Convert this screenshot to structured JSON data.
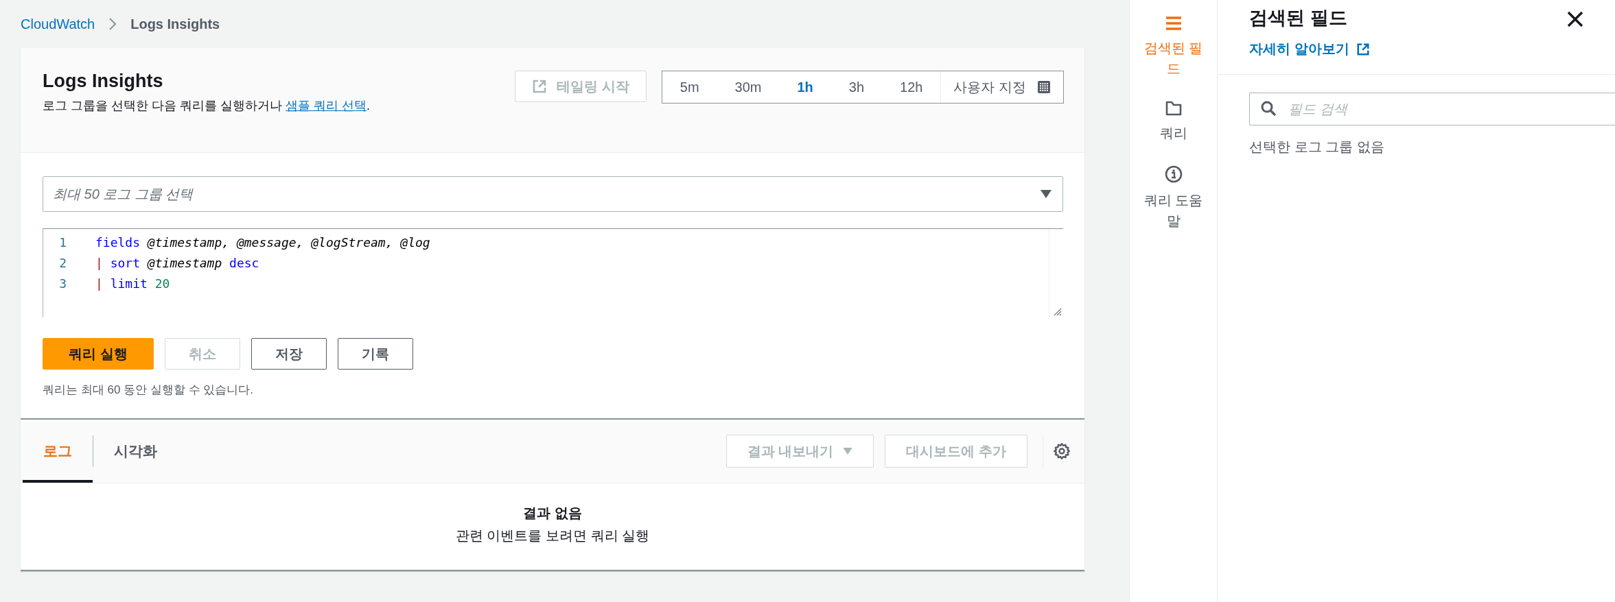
{
  "breadcrumb": [
    {
      "label": "CloudWatch",
      "kind": "link"
    },
    {
      "label": "Logs Insights",
      "kind": "current"
    }
  ],
  "header": {
    "title": "Logs Insights",
    "description": {
      "before": "로그 그룹을 선택한 다음 쿼리를 실행하거나 ",
      "link": "샘플 쿼리 선택",
      "after": "."
    },
    "tail_button": {
      "label": "테일링 시작",
      "disabled": true
    },
    "time_ranges": [
      {
        "label": "5m",
        "selected": false
      },
      {
        "label": "30m",
        "selected": false
      },
      {
        "label": "1h",
        "selected": true
      },
      {
        "label": "3h",
        "selected": false
      },
      {
        "label": "12h",
        "selected": false
      },
      {
        "label": "사용자 지정",
        "selected": false
      }
    ]
  },
  "log_group_select": {
    "placeholder": "최대 50 로그 그룹 선택"
  },
  "editor": {
    "lines": [
      {
        "number": "1",
        "tokens": [
          {
            "text": "fields",
            "kind": "keyword"
          },
          {
            "text": " @timestamp, @message, @logStream, @log",
            "kind": "field"
          }
        ]
      },
      {
        "number": "2",
        "tokens": [
          {
            "text": "|",
            "kind": "pipe"
          },
          {
            "text": " sort",
            "kind": "keyword"
          },
          {
            "text": " @timestamp",
            "kind": "field"
          },
          {
            "text": " desc",
            "kind": "keyword"
          }
        ]
      },
      {
        "number": "3",
        "tokens": [
          {
            "text": "|",
            "kind": "pipe"
          },
          {
            "text": " limit",
            "kind": "keyword"
          },
          {
            "text": " 20",
            "kind": "number"
          }
        ]
      }
    ]
  },
  "actions": [
    {
      "label": "쿼리 실행",
      "kind": "primary",
      "disabled": false
    },
    {
      "label": "취소",
      "kind": "normal",
      "disabled": true
    },
    {
      "label": "저장",
      "kind": "normal",
      "disabled": false
    },
    {
      "label": "기록",
      "kind": "normal",
      "disabled": false
    }
  ],
  "hint": "쿼리는 최대 60 동안 실행할 수 있습니다.",
  "results": {
    "tabs": [
      {
        "label": "로그",
        "selected": true
      },
      {
        "label": "시각화",
        "selected": false
      }
    ],
    "export_button": {
      "label": "결과 내보내기",
      "disabled": true
    },
    "dashboard_button": {
      "label": "대시보드에 추가",
      "disabled": true
    },
    "empty_title": "결과 없음",
    "empty_text": "관련 이벤트를 보려면 쿼리 실행"
  },
  "rail": [
    {
      "label": "검색된 필드",
      "kind": "fields",
      "selected": true
    },
    {
      "label": "쿼리",
      "kind": "queries",
      "selected": false
    },
    {
      "label": "쿼리 도움말",
      "kind": "help",
      "selected": false
    }
  ],
  "panel": {
    "title": "검색된 필드",
    "link": "자세히 알아보기",
    "search_placeholder": "필드 검색",
    "empty_text": "선택한 로그 그룹 없음"
  }
}
